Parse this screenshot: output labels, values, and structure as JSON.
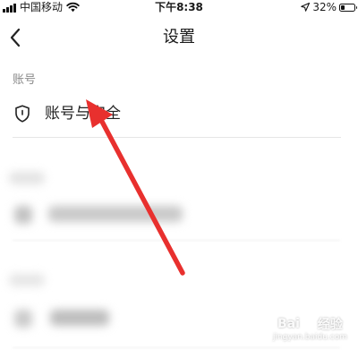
{
  "status_bar": {
    "carrier": "中国移动",
    "time": "下午8:38",
    "battery_text": "32%",
    "battery_level": 0.32,
    "signal_icon": "signal-bars-icon",
    "wifi_icon": "wifi-icon",
    "location_icon": "location-arrow-icon"
  },
  "nav": {
    "title": "设置",
    "back_icon": "chevron-left-icon"
  },
  "sections": [
    {
      "header": "账号",
      "items": [
        {
          "label": "账号与安全",
          "icon": "shield-icon"
        }
      ]
    }
  ],
  "annotation": {
    "color": "#e8302e"
  },
  "watermark": {
    "brand_left": "Bai",
    "brand_right": "经验",
    "url": "jingyan.baidu.com"
  }
}
